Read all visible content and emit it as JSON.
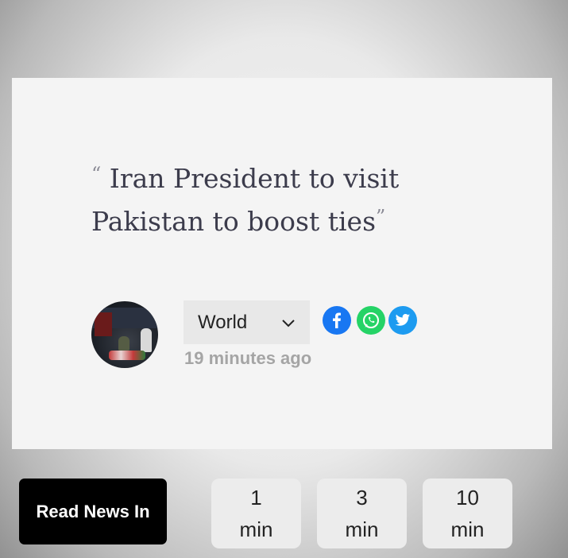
{
  "headline": {
    "open_quote": "“",
    "text": "Iran President to visit Pakistan to boost ties",
    "close_quote": "”"
  },
  "meta": {
    "category": "World",
    "time_ago": "19 minutes ago"
  },
  "share": [
    {
      "icon": "facebook-icon",
      "color": "#1877f2"
    },
    {
      "icon": "whatsapp-icon",
      "color": "#25d366"
    },
    {
      "icon": "twitter-icon",
      "color": "#1d9bf0"
    }
  ],
  "bottom_bar": {
    "read_label": "Read News In",
    "options": [
      {
        "value": "1",
        "unit": "min"
      },
      {
        "value": "3",
        "unit": "min"
      },
      {
        "value": "10",
        "unit": "min"
      }
    ]
  }
}
